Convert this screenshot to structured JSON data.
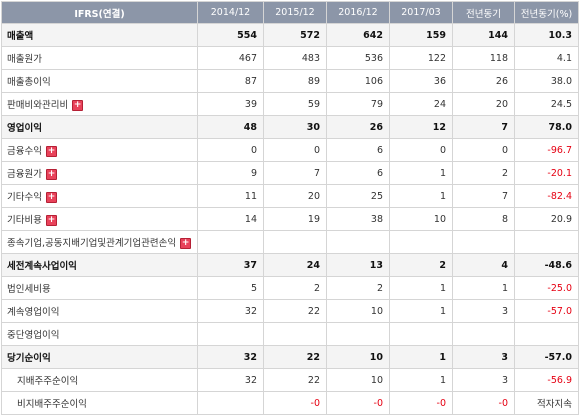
{
  "colors": {
    "header_bg": "#8c96a8",
    "negative": "#e60012",
    "expand_icon": "#e8425a"
  },
  "table": {
    "headers": [
      "IFRS(연결)",
      "2014/12",
      "2015/12",
      "2016/12",
      "2017/03",
      "전년동기",
      "전년동기(%)"
    ],
    "rows": [
      {
        "label": "매출액",
        "bold": true,
        "values": [
          "554",
          "572",
          "642",
          "159",
          "144",
          "10.3"
        ]
      },
      {
        "label": "매출원가",
        "values": [
          "467",
          "483",
          "536",
          "122",
          "118",
          "4.1"
        ]
      },
      {
        "label": "매출총이익",
        "values": [
          "87",
          "89",
          "106",
          "36",
          "26",
          "38.0"
        ]
      },
      {
        "label": "판매비와관리비",
        "expand": true,
        "values": [
          "39",
          "59",
          "79",
          "24",
          "20",
          "24.5"
        ]
      },
      {
        "label": "영업이익",
        "bold": true,
        "values": [
          "48",
          "30",
          "26",
          "12",
          "7",
          "78.0"
        ]
      },
      {
        "label": "금융수익",
        "expand": true,
        "values": [
          "0",
          "0",
          "6",
          "0",
          "0",
          "-96.7"
        ],
        "negative": [
          false,
          false,
          false,
          false,
          false,
          true
        ]
      },
      {
        "label": "금융원가",
        "expand": true,
        "values": [
          "9",
          "7",
          "6",
          "1",
          "2",
          "-20.1"
        ],
        "negative": [
          false,
          false,
          false,
          false,
          false,
          true
        ]
      },
      {
        "label": "기타수익",
        "expand": true,
        "values": [
          "11",
          "20",
          "25",
          "1",
          "7",
          "-82.4"
        ],
        "negative": [
          false,
          false,
          false,
          false,
          false,
          true
        ]
      },
      {
        "label": "기타비용",
        "expand": true,
        "values": [
          "14",
          "19",
          "38",
          "10",
          "8",
          "20.9"
        ]
      },
      {
        "label": "종속기업,공동지배기업및관계기업관련손익",
        "expand": true,
        "values": [
          "",
          "",
          "",
          "",
          "",
          ""
        ]
      },
      {
        "label": "세전계속사업이익",
        "bold": true,
        "values": [
          "37",
          "24",
          "13",
          "2",
          "4",
          "-48.6"
        ],
        "negative": [
          false,
          false,
          false,
          false,
          false,
          true
        ]
      },
      {
        "label": "법인세비용",
        "values": [
          "5",
          "2",
          "2",
          "1",
          "1",
          "-25.0"
        ],
        "negative": [
          false,
          false,
          false,
          false,
          false,
          true
        ]
      },
      {
        "label": "계속영업이익",
        "values": [
          "32",
          "22",
          "10",
          "1",
          "3",
          "-57.0"
        ],
        "negative": [
          false,
          false,
          false,
          false,
          false,
          true
        ]
      },
      {
        "label": "중단영업이익",
        "values": [
          "",
          "",
          "",
          "",
          "",
          ""
        ]
      },
      {
        "label": "당기순이익",
        "bold": true,
        "values": [
          "32",
          "22",
          "10",
          "1",
          "3",
          "-57.0"
        ],
        "negative": [
          false,
          false,
          false,
          false,
          false,
          true
        ]
      },
      {
        "label": "지배주주순이익",
        "indent": true,
        "values": [
          "32",
          "22",
          "10",
          "1",
          "3",
          "-56.9"
        ],
        "negative": [
          false,
          false,
          false,
          false,
          false,
          true
        ]
      },
      {
        "label": "비지배주주순이익",
        "indent": true,
        "values": [
          "",
          "-0",
          "-0",
          "-0",
          "-0",
          "적자지속"
        ],
        "negative": [
          false,
          true,
          true,
          true,
          true,
          false
        ]
      }
    ]
  }
}
